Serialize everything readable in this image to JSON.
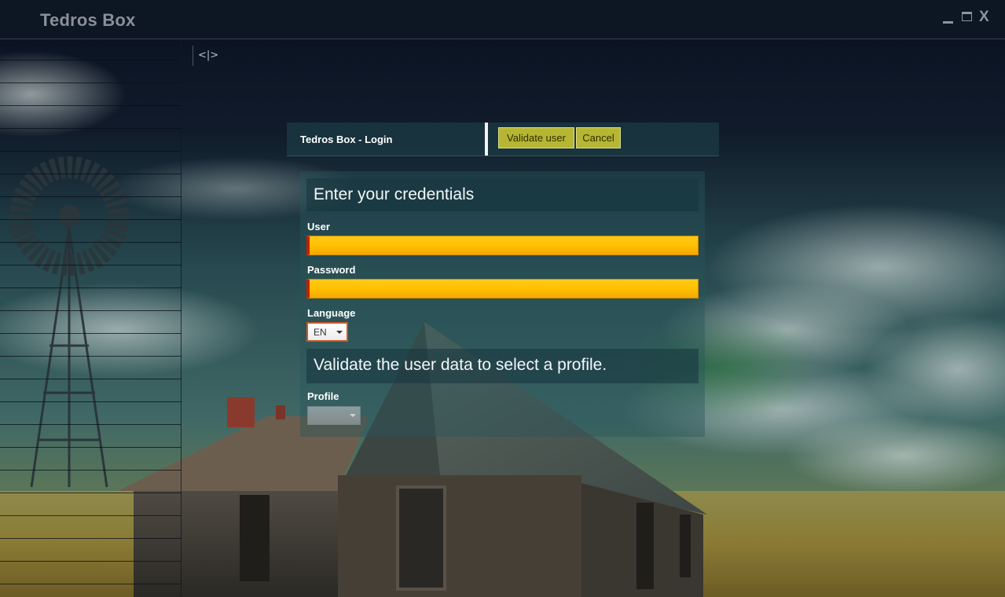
{
  "window": {
    "title": "Tedros Box",
    "controls": {
      "minimize_icon": "minimize-icon",
      "maximize_icon": "maximize-icon",
      "close_label": "X"
    }
  },
  "sidebar": {
    "toggle_label": "<|>"
  },
  "dialog": {
    "title": "Tedros Box - Login",
    "buttons": {
      "validate_label": "Validate user",
      "cancel_label": "Cancel"
    },
    "credentials_title": "Enter your credentials",
    "fields": {
      "user_label": "User",
      "user_value": "",
      "password_label": "Password",
      "password_value": "",
      "language_label": "Language",
      "language_value": "EN"
    },
    "profile_hint": "Validate the user data to select a profile.",
    "profile": {
      "label": "Profile",
      "value": ""
    }
  },
  "colors": {
    "accent_button": "#b6b634",
    "field_fill": "#ffc000",
    "field_error": "#c21f00",
    "title_bar": "#0d1623"
  }
}
